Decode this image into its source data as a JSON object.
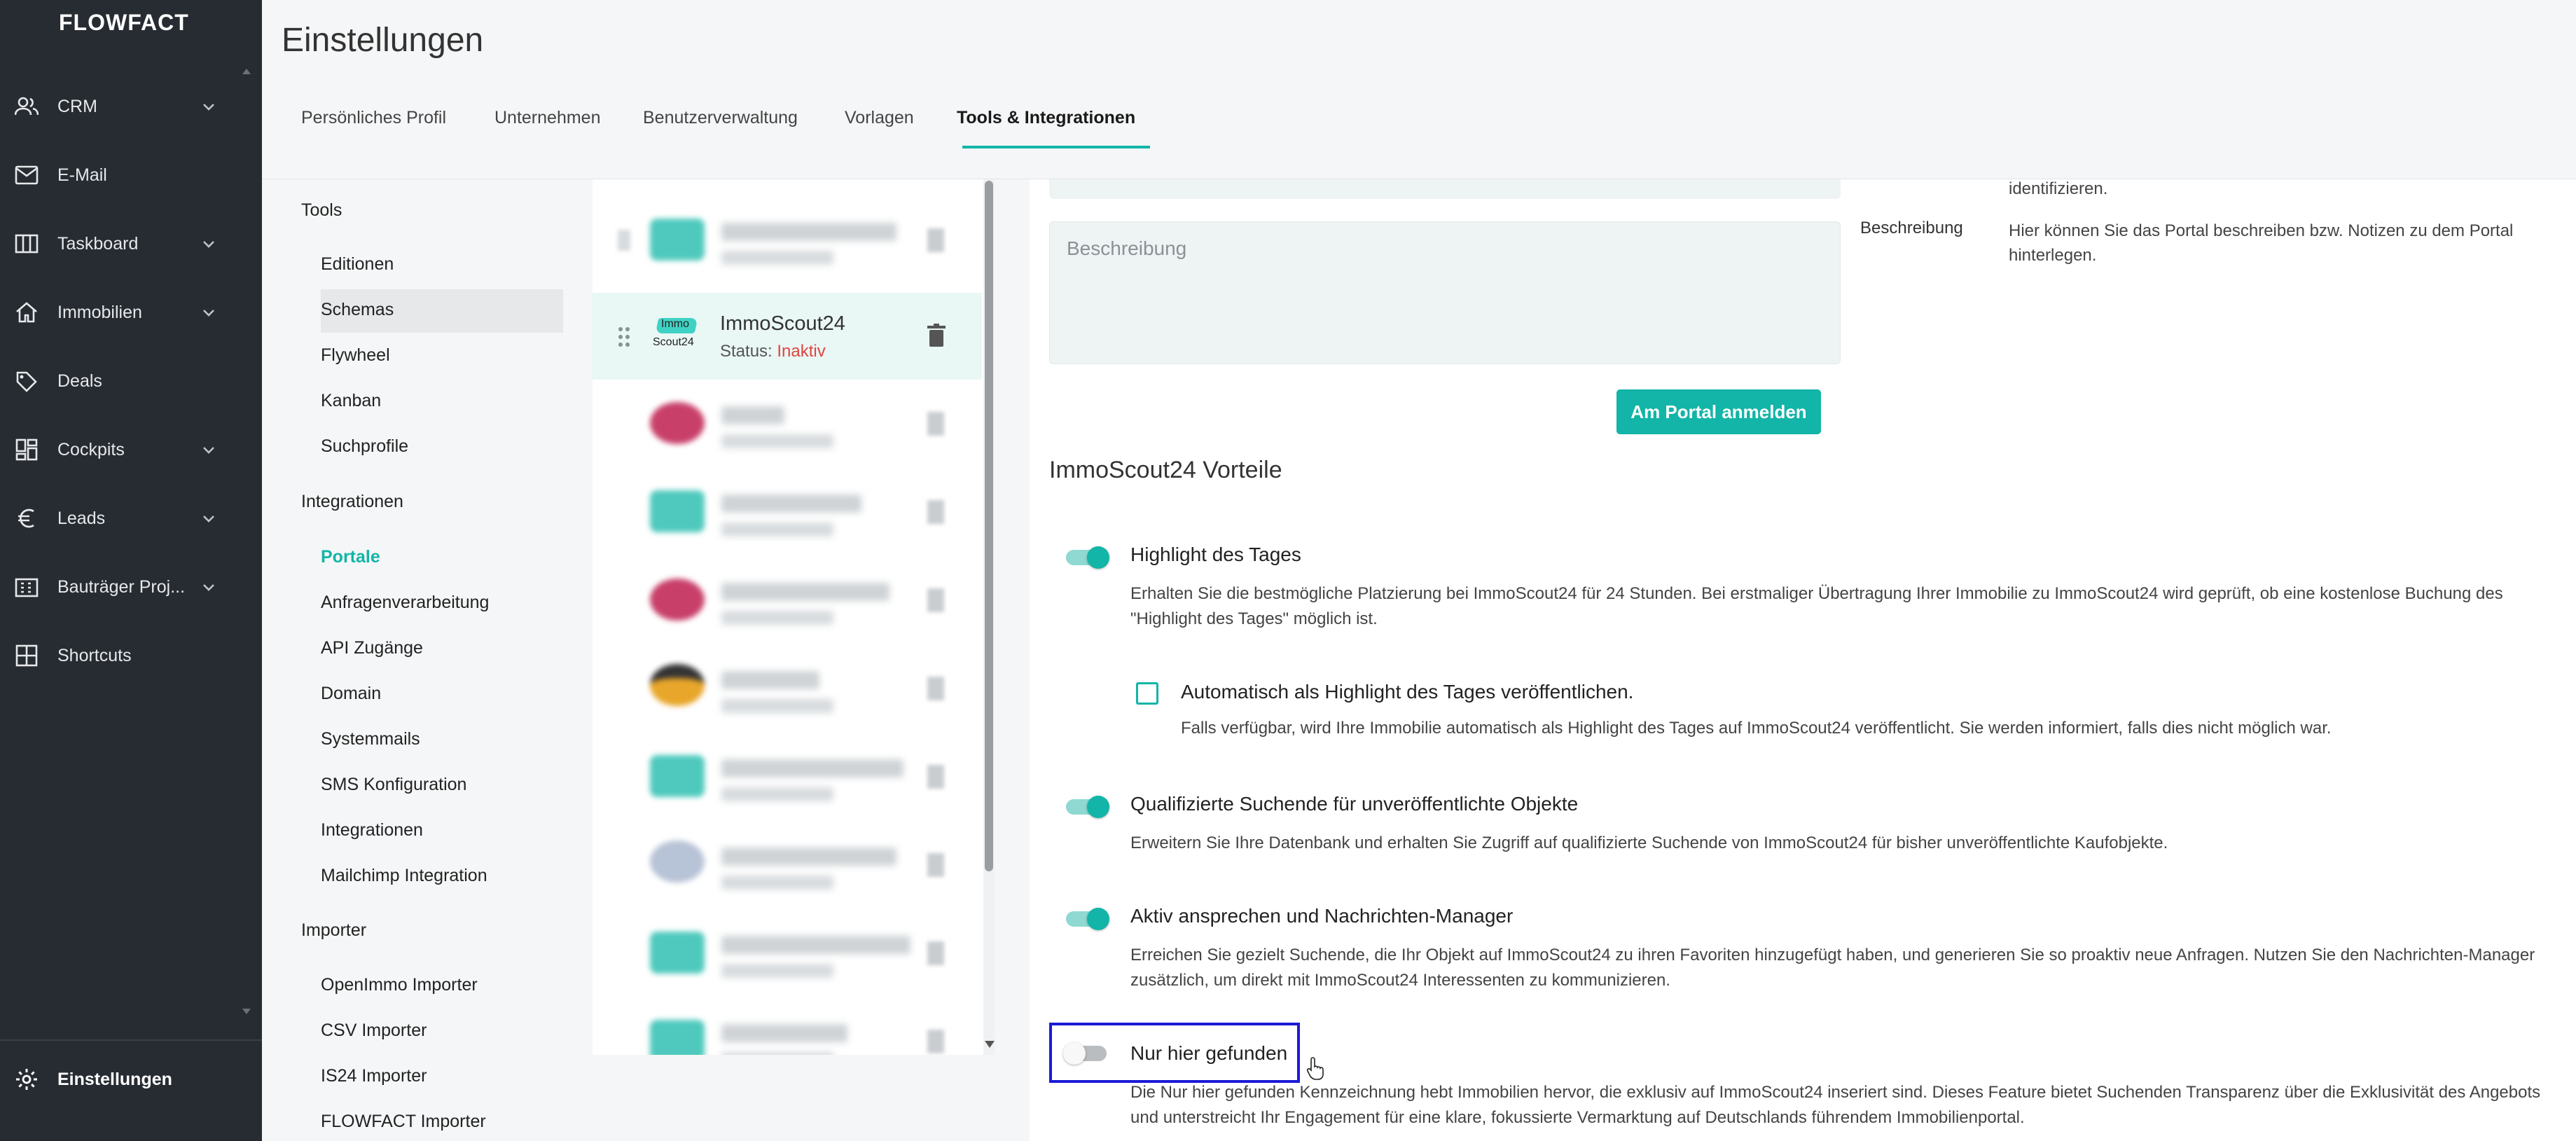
{
  "sidebar": {
    "logo": "FLOWFACT",
    "items": [
      {
        "label": "CRM",
        "icon": "people-icon"
      },
      {
        "label": "E-Mail",
        "icon": "mail-icon"
      },
      {
        "label": "Taskboard",
        "icon": "board-icon"
      },
      {
        "label": "Immobilien",
        "icon": "home-icon"
      },
      {
        "label": "Deals",
        "icon": "handshake-icon"
      },
      {
        "label": "Cockpits",
        "icon": "dashboard-icon"
      },
      {
        "label": "Leads",
        "icon": "euro-icon"
      },
      {
        "label": "Bauträger Proj...",
        "icon": "building-icon"
      },
      {
        "label": "Shortcuts",
        "icon": "grid-icon"
      }
    ],
    "settings_label": "Einstellungen"
  },
  "header": {
    "title": "Einstellungen",
    "tabs": [
      {
        "label": "Persönliches Profil"
      },
      {
        "label": "Unternehmen"
      },
      {
        "label": "Benutzerverwaltung"
      },
      {
        "label": "Vorlagen"
      },
      {
        "label": "Tools & Integrationen"
      }
    ]
  },
  "menu": {
    "tools_title": "Tools",
    "tools": [
      "Editionen",
      "Schemas",
      "Flywheel",
      "Kanban",
      "Suchprofile"
    ],
    "integrations_title": "Integrationen",
    "integrations": [
      "Portale",
      "Anfragenverarbeitung",
      "API Zugänge",
      "Domain",
      "Systemmails",
      "SMS Konfiguration",
      "Integrationen",
      "Mailchimp Integration"
    ],
    "importer_title": "Importer",
    "importers": [
      "OpenImmo Importer",
      "CSV Importer",
      "IS24 Importer",
      "FLOWFACT Importer"
    ]
  },
  "portal_list": {
    "selected_name": "ImmoScout24",
    "status_label": "Status:",
    "status_value": "Inaktiv",
    "logo_text_top": "Immo",
    "logo_text_bottom": "Scout24"
  },
  "content": {
    "help_top": "identifizieren.",
    "description_placeholder": "Beschreibung",
    "help_label": "Beschreibung",
    "help_text": "Hier können Sie das Portal beschreiben bzw. Notizen zu dem Portal hinterlegen.",
    "login_button": "Am Portal anmelden",
    "section_title": "ImmoScout24 Vorteile",
    "features": [
      {
        "title": "Highlight des Tages",
        "desc": "Erhalten Sie die bestmögliche Platzierung bei ImmoScout24 für 24 Stunden. Bei erstmaliger Übertragung Ihrer Immobilie zu ImmoScout24 wird geprüft, ob eine kostenlose Buchung des \"Highlight des Tages\" möglich ist.",
        "enabled": true
      },
      {
        "title": "Qualifizierte Suchende für unveröffentlichte Objekte",
        "desc": "Erweitern Sie Ihre Datenbank und erhalten Sie Zugriff auf qualifizierte Suchende von ImmoScout24 für bisher unveröffentlichte Kaufobjekte.",
        "enabled": true
      },
      {
        "title": "Aktiv ansprechen und Nachrichten-Manager",
        "desc": "Erreichen Sie gezielt Suchende, die Ihr Objekt auf ImmoScout24 zu ihren Favoriten hinzugefügt haben, und generieren Sie so proaktiv neue Anfragen. Nutzen Sie den Nachrichten-Manager zusätzlich, um direkt mit ImmoScout24 Interessenten zu kommunizieren.",
        "enabled": true
      },
      {
        "title": "Nur hier gefunden",
        "desc": "Die Nur hier gefunden Kennzeichnung hebt Immobilien hervor, die exklusiv auf ImmoScout24 inseriert sind. Dieses Feature bietet Suchenden Transparenz über die Exklusivität des Angebots und unterstreicht Ihr Engagement für eine klare, fokussierte Vermarktung auf Deutschlands führendem Immobilienportal.",
        "enabled": false
      }
    ],
    "auto_highlight_label": "Automatisch als Highlight des Tages veröffentlichen.",
    "auto_highlight_desc": "Falls verfügbar, wird Ihre Immobilie automatisch als Highlight des Tages auf ImmoScout24 veröffentlicht. Sie werden informiert, falls dies nicht möglich war."
  },
  "colors": {
    "accent": "#12b5a7",
    "sidebar": "#272c33",
    "inactive": "#e0443e",
    "focus": "#1b1bd6"
  }
}
